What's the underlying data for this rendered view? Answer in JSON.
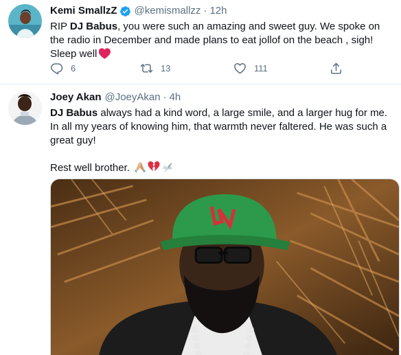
{
  "tweets": [
    {
      "author_name": "Kemi SmallzZ",
      "handle": "@kemismallzz",
      "separator": "·",
      "time": "12h",
      "text_1": "RIP ",
      "mention": "DJ Babus",
      "text_2": ", you were such an amazing and sweet guy.  We spoke on the radio in December and made plans to eat jollof on the beach , sigh!",
      "text_3": "Sleep well",
      "replies": "6",
      "retweets": "13",
      "likes": "111"
    },
    {
      "author_name": "Joey Akan",
      "handle": "@JoeyAkan",
      "separator": "·",
      "time": "4h",
      "mention": "DJ Babus",
      "text_1": " always had a kind word, a large smile, and a larger hug for me. In all my years of knowing him, that warmth never faltered. He was such a great guy!",
      "text_2": "Rest well brother."
    }
  ],
  "colors": {
    "text": "#0f1419",
    "secondary": "#5b7083",
    "verified": "#1da1f2",
    "divider": "#e6ecf0",
    "heart": "#e0245e"
  },
  "icons": [
    "verified-badge-icon",
    "reply-icon",
    "retweet-icon",
    "like-icon",
    "share-icon",
    "heart-emoji",
    "praying-hands-emoji",
    "broken-heart-emoji",
    "dove-emoji"
  ]
}
